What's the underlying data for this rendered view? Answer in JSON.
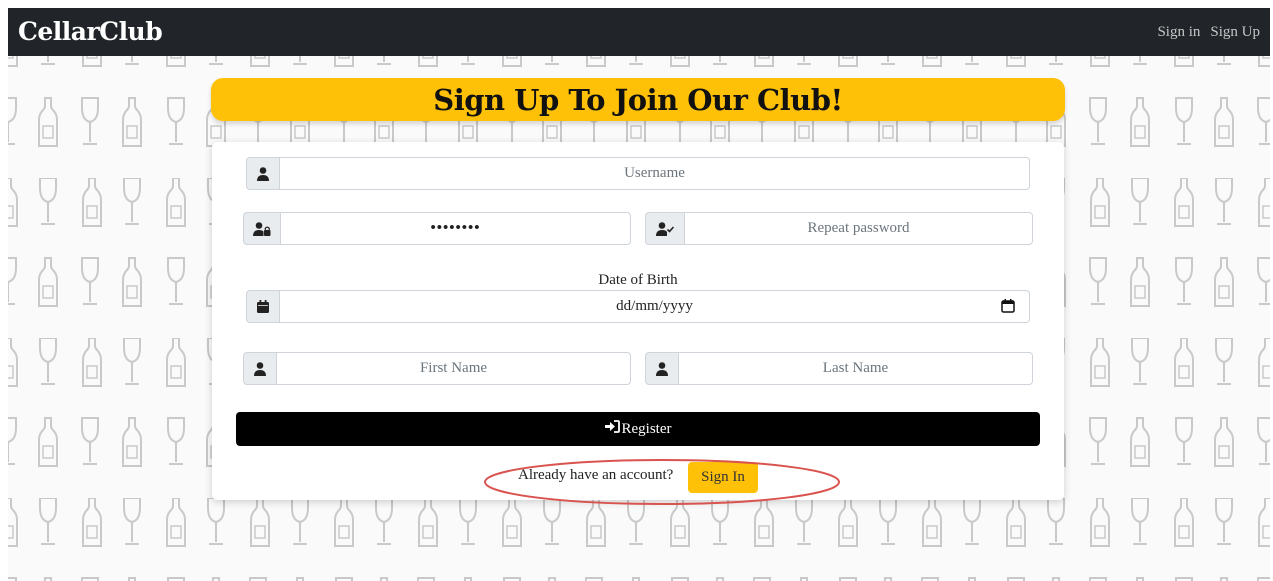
{
  "navbar": {
    "brand": "CellarClub",
    "links": [
      "Sign in",
      "Sign Up"
    ]
  },
  "page": {
    "title": "Sign Up To Join Our Club!"
  },
  "form": {
    "username_placeholder": "Username",
    "password_value": "••••••••",
    "repeat_password_placeholder": "Repeat password",
    "dob_label": "Date of Birth",
    "dob_value": "dd/mm/yyyy",
    "first_name_placeholder": "First Name",
    "last_name_placeholder": "Last Name",
    "register_label": "Register",
    "already_text": "Already have an account?",
    "signin_label": "Sign In"
  },
  "colors": {
    "navbar": "#212529",
    "accent": "#ffc107",
    "register": "#000000",
    "annotation": "#d9534f"
  },
  "icons": [
    "user-icon",
    "user-lock-icon",
    "user-check-icon",
    "calendar-icon",
    "sign-in-icon"
  ]
}
